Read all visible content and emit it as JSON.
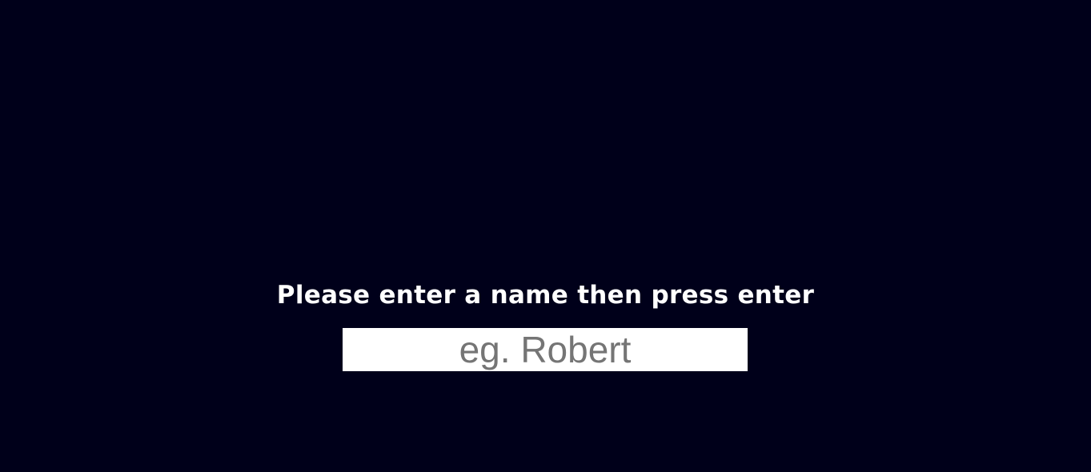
{
  "prompt": {
    "text": "Please enter a name then press enter"
  },
  "name_input": {
    "value": "",
    "placeholder": "eg. Robert"
  },
  "colors": {
    "background": "#00001a",
    "prompt_text": "#ffffff",
    "input_background": "#ffffff",
    "placeholder_text": "#757575"
  }
}
